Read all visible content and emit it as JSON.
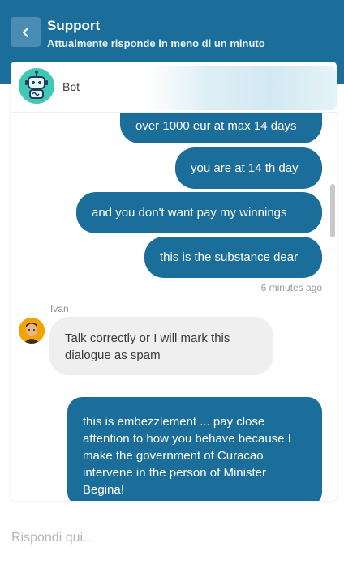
{
  "header": {
    "title": "Support",
    "subtitle": "Attualmente risponde in meno di un minuto",
    "background": "#1a6e99",
    "back_icon": "chevron-left-icon"
  },
  "agent": {
    "name": "Bot",
    "avatar_icon": "robot-icon"
  },
  "messages": [
    {
      "from": "user",
      "text": "over 1000 eur at max 14 days"
    },
    {
      "from": "user",
      "text": "you are at 14 th day"
    },
    {
      "from": "user",
      "text": "and you don't want pay my winnings"
    },
    {
      "from": "user",
      "text": "this is the substance dear"
    },
    {
      "from": "agent",
      "sender": "Ivan",
      "text": "Talk correctly or I will mark this dialogue as spam"
    },
    {
      "from": "user",
      "text": "this is embezzlement ... pay close attention to how you behave because I make the government of Curacao intervene in the person of Minister Begina!"
    }
  ],
  "timestamp": "6 minutes ago",
  "composer": {
    "placeholder": "Rispondi qui..."
  },
  "colors": {
    "outgoing_bubble": "#1a6e99",
    "incoming_bubble": "#efefef"
  }
}
